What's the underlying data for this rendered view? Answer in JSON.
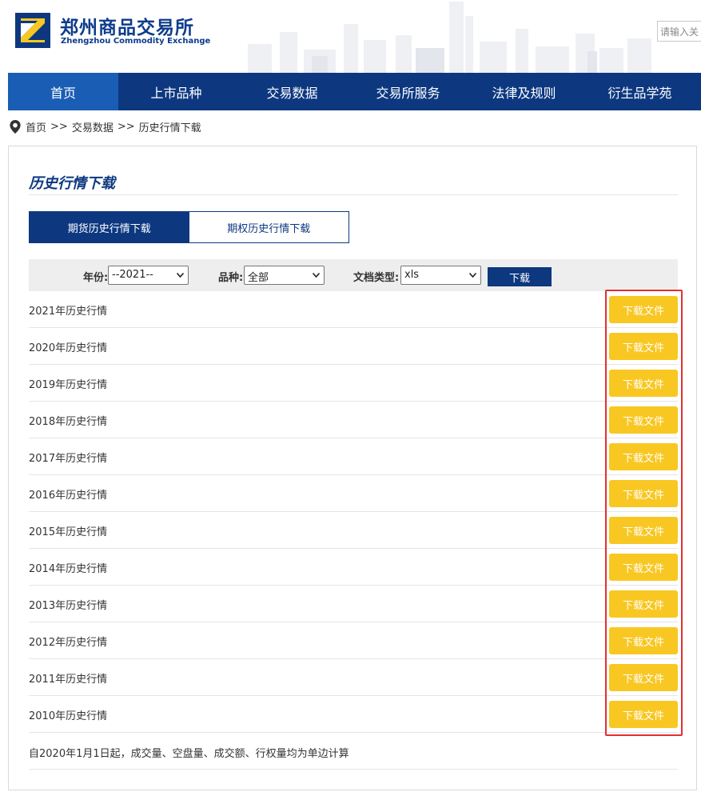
{
  "header": {
    "logo_cn": "郑州商品交易所",
    "logo_en": "Zhengzhou Commodity Exchange",
    "search_placeholder": "请输入关"
  },
  "nav": {
    "items": [
      {
        "label": "首页",
        "active": true
      },
      {
        "label": "上市品种"
      },
      {
        "label": "交易数据"
      },
      {
        "label": "交易所服务"
      },
      {
        "label": "法律及规则"
      },
      {
        "label": "衍生品学苑"
      }
    ]
  },
  "breadcrumb": {
    "home": "首页",
    "sep1": ">>",
    "level1": "交易数据",
    "sep2": ">>",
    "level2": "历史行情下载"
  },
  "panel": {
    "title": "历史行情下载",
    "tabs": [
      {
        "label": "期货历史行情下载",
        "active": true
      },
      {
        "label": "期权历史行情下载"
      }
    ],
    "filter": {
      "year_label": "年份:",
      "year_value": "--2021--",
      "product_label": "品种:",
      "product_value": "全部",
      "filetype_label": "文档类型:",
      "filetype_value": "xls",
      "download_label": "下载"
    },
    "rows": [
      {
        "label": "2021年历史行情",
        "button": "下载文件"
      },
      {
        "label": "2020年历史行情",
        "button": "下载文件"
      },
      {
        "label": "2019年历史行情",
        "button": "下载文件"
      },
      {
        "label": "2018年历史行情",
        "button": "下载文件"
      },
      {
        "label": "2017年历史行情",
        "button": "下载文件"
      },
      {
        "label": "2016年历史行情",
        "button": "下载文件"
      },
      {
        "label": "2015年历史行情",
        "button": "下载文件"
      },
      {
        "label": "2014年历史行情",
        "button": "下载文件"
      },
      {
        "label": "2013年历史行情",
        "button": "下载文件"
      },
      {
        "label": "2012年历史行情",
        "button": "下载文件"
      },
      {
        "label": "2011年历史行情",
        "button": "下载文件"
      },
      {
        "label": "2010年历史行情",
        "button": "下载文件"
      }
    ],
    "note": "自2020年1月1日起，成交量、空盘量、成交额、行权量均为单边计算"
  },
  "colors": {
    "brand": "#0d3880",
    "nav_active": "#1a5db5",
    "file_button": "#f8c722",
    "highlight": "#e23030"
  }
}
